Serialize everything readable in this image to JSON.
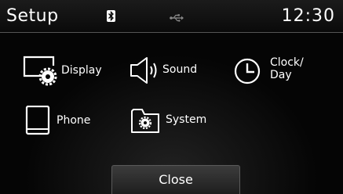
{
  "header": {
    "title": "Setup",
    "time": "12:30",
    "icons": [
      "bluetooth-icon",
      "usb-icon"
    ]
  },
  "menu": {
    "display": {
      "label": "Display",
      "icon": "display-settings-icon"
    },
    "sound": {
      "label": "Sound",
      "icon": "speaker-icon"
    },
    "clock": {
      "label_line1": "Clock/",
      "label_line2": "Day",
      "icon": "clock-icon"
    },
    "phone": {
      "label": "Phone",
      "icon": "phone-icon"
    },
    "system": {
      "label": "System",
      "icon": "system-folder-icon"
    }
  },
  "footer": {
    "close_label": "Close"
  },
  "colors": {
    "background": "#000000",
    "text": "#ffffff",
    "button": "#2e2e2e"
  }
}
